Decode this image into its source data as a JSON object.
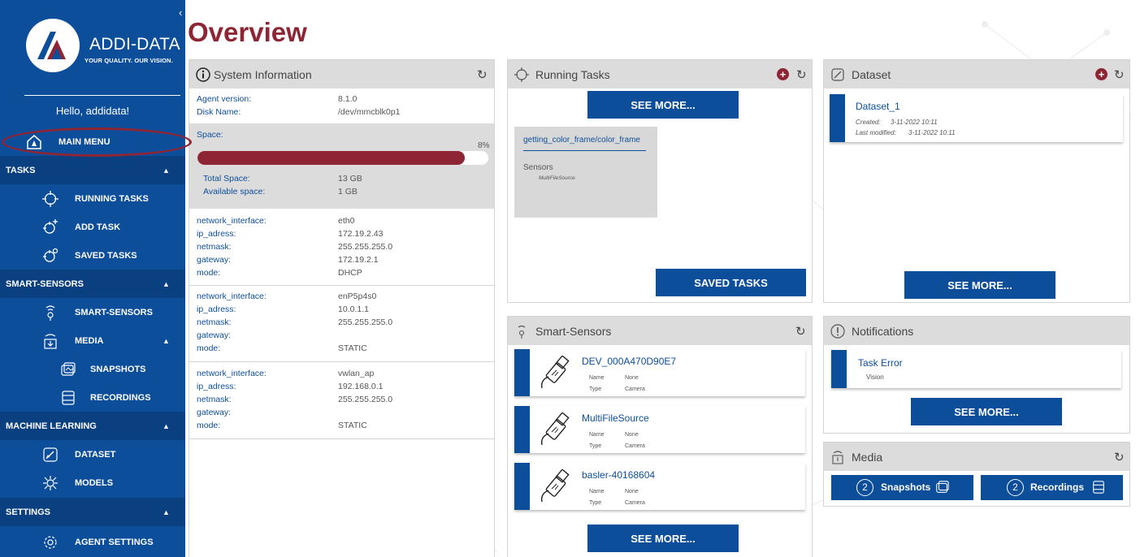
{
  "sidebar": {
    "brand_name": "ADDI-DATA",
    "brand_tagline": "YOUR QUALITY. OUR VISION.",
    "greeting": "Hello, addidata!",
    "main_menu": "MAIN MENU",
    "sections": {
      "tasks": "TASKS",
      "smart_sensors": "SMART-SENSORS",
      "machine_learning": "MACHINE LEARNING",
      "settings": "SETTINGS"
    },
    "items": {
      "running_tasks": "RUNNING TASKS",
      "add_task": "ADD TASK",
      "saved_tasks": "SAVED TASKS",
      "smart_sensors": "SMART-SENSORS",
      "media": "MEDIA",
      "snapshots": "SNAPSHOTS",
      "recordings": "RECORDINGS",
      "dataset": "DATASET",
      "models": "MODELS",
      "agent_settings": "AGENT SETTINGS"
    }
  },
  "page_title": "Overview",
  "system_info": {
    "title": "System Information",
    "agent_version_label": "Agent version:",
    "agent_version": "8.1.0",
    "disk_name_label": "Disk Name:",
    "disk_name": "/dev/mmcblk0p1",
    "space_label": "Space:",
    "space_percent_text": "8%",
    "space_used_fraction": 0.92,
    "total_space_label": "Total Space:",
    "total_space": "13 GB",
    "available_space_label": "Available space:",
    "available_space": "1 GB",
    "interfaces": [
      {
        "labels": [
          "network_interface:",
          "ip_adress:",
          "netmask:",
          "gateway:",
          "mode:"
        ],
        "values": [
          "eth0",
          "172.19.2.43",
          "255.255.255.0",
          "172.19.2.1",
          "DHCP"
        ]
      },
      {
        "labels": [
          "network_interface:",
          "ip_adress:",
          "netmask:",
          "gateway:",
          "mode:"
        ],
        "values": [
          "enP5p4s0",
          "10.0.1.1",
          "255.255.255.0",
          "",
          "STATIC"
        ]
      },
      {
        "labels": [
          "network_interface:",
          "ip_adress:",
          "netmask:",
          "gateway:",
          "mode:"
        ],
        "values": [
          "vwlan_ap",
          "192.168.0.1",
          "255.255.255.0",
          "",
          "STATIC"
        ]
      }
    ]
  },
  "running_tasks": {
    "title": "Running Tasks",
    "see_more": "SEE MORE...",
    "task_name": "getting_color_frame/color_frame",
    "sensors_label": "Sensors",
    "sensor_source": "MultiFileSource",
    "saved_tasks_button": "SAVED TASKS"
  },
  "dataset": {
    "title": "Dataset",
    "item_name": "Dataset_1",
    "created_label": "Created:",
    "created": "3-11-2022 10:11",
    "modified_label": "Last modified:",
    "modified": "3-11-2022 10:11",
    "see_more": "SEE MORE..."
  },
  "smart_sensors": {
    "title": "Smart-Sensors",
    "name_label": "Name",
    "type_label": "Type",
    "items": [
      {
        "id": "DEV_000A470D90E7",
        "name": "None",
        "type": "Camera"
      },
      {
        "id": "MultiFileSource",
        "name": "None",
        "type": "Camera"
      },
      {
        "id": "basler-40168604",
        "name": "None",
        "type": "Camera"
      }
    ],
    "see_more": "SEE MORE..."
  },
  "notifications": {
    "title": "Notifications",
    "item_title": "Task Error",
    "item_source": "Vision",
    "see_more": "SEE MORE..."
  },
  "media": {
    "title": "Media",
    "snapshots_count": "2",
    "snapshots_label": "Snapshots",
    "recordings_count": "2",
    "recordings_label": "Recordings"
  },
  "colors": {
    "primary_blue": "#0d4e9b",
    "accent_red": "#8e2535",
    "panel_header_gray": "#dcdcdc"
  }
}
